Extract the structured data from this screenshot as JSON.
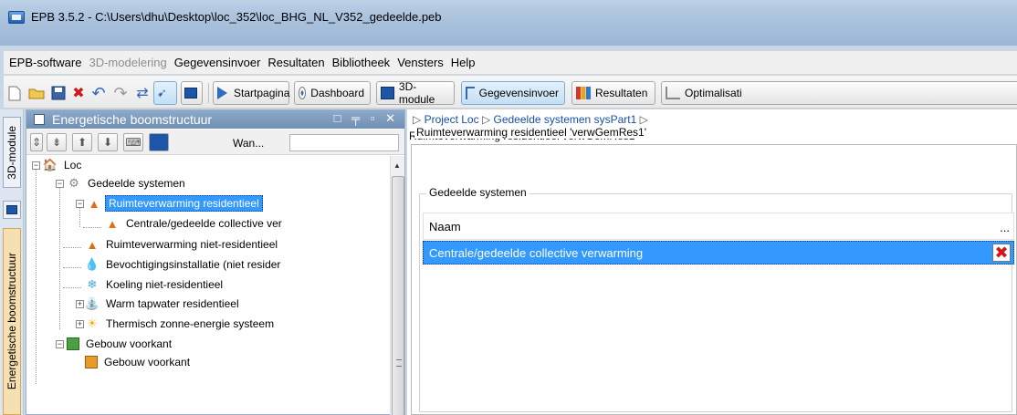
{
  "window": {
    "title": "EPB 3.5.2 - C:\\Users\\dhu\\Desktop\\loc_352\\loc_BHG_NL_V352_gedeelde.peb"
  },
  "menu": [
    {
      "label": "EPB-software",
      "disabled": false
    },
    {
      "label": "3D-modelering",
      "disabled": true
    },
    {
      "label": "Gegevensinvoer",
      "disabled": false
    },
    {
      "label": "Resultaten",
      "disabled": false
    },
    {
      "label": "Bibliotheek",
      "disabled": false
    },
    {
      "label": "Vensters",
      "disabled": false
    },
    {
      "label": "Help",
      "disabled": false
    }
  ],
  "toolbar": {
    "startpagina": "Startpagina",
    "dashboard": "Dashboard",
    "module3d": "3D-module",
    "gegevensinvoer": "Gegevensinvoer",
    "resultaten": "Resultaten",
    "optimalisatie": "Optimalisati"
  },
  "side_tabs": {
    "module3d": "3D-module",
    "boomstructuur": "Energetische boomstructuur"
  },
  "left_panel": {
    "title": "Energetische boomstructuur",
    "controls": "□ ╤ ▫ ✕",
    "wan_label": "Wan...",
    "tree": [
      {
        "label": "Loc",
        "icon": "house-icon"
      },
      {
        "label": "Gedeelde systemen",
        "icon": "gear-icon"
      },
      {
        "label": "Ruimteverwarming residentieel",
        "icon": "flame-icon",
        "selected": true
      },
      {
        "label": "Centrale/gedeelde collective ver",
        "icon": "flame-icon"
      },
      {
        "label": "Ruimteverwarming niet-residentieel",
        "icon": "flame-icon"
      },
      {
        "label": "Bevochtigingsinstallatie (niet resider",
        "icon": "drop-icon"
      },
      {
        "label": "Koeling niet-residentieel",
        "icon": "snowflake-icon"
      },
      {
        "label": "Warm tapwater residentieel",
        "icon": "faucet-icon"
      },
      {
        "label": "Thermisch zonne-energie systeem",
        "icon": "sun-icon"
      },
      {
        "label": "Gebouw voorkant",
        "icon": "cube-icon"
      },
      {
        "label": "Gebouw voorkant",
        "icon": "cube-icon"
      }
    ]
  },
  "right_panel": {
    "breadcrumb": [
      "Project Loc",
      "Gedeelde systemen sysPart1"
    ],
    "subtitle": "Ruimteverwarming residentieel verwGemRes1",
    "box_title": "Ruimteverwarming residentieel 'verwGemRes1'",
    "group_title": "Gedeelde systemen",
    "grid": {
      "header": "Naam",
      "header_more": "...",
      "rows": [
        "Centrale/gedeelde collective verwarming"
      ]
    }
  },
  "colors": {
    "selection": "#3399ff",
    "title_bar": "#a9c1dc",
    "delete": "#d01818"
  }
}
